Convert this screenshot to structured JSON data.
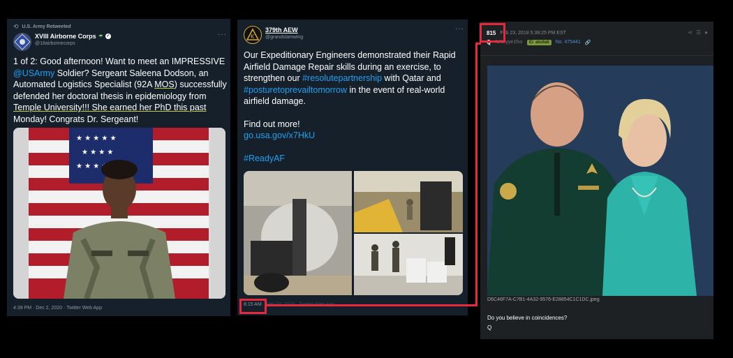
{
  "tweet1": {
    "retweet_label": "U.S. Army Retweeted",
    "display_name": "XVIII Airborne Corps",
    "handle": "@18airbornecorps",
    "text_line1": "1 of 2: Good afternoon! Want to meet an IMPRESSIVE",
    "mention": "@USArmy",
    "text_line2": " Soldier? Sergeant Saleena Dodson, an",
    "text_line3": "Automated Logistics Specialist (92A ",
    "text_mos": "MOS",
    "text_line3b": ") successfully",
    "text_line4": "defended her doctoral thesis in epidemiology from",
    "text_line5": "Temple University!!! She earned her PhD this past",
    "text_line6": "Monday! Congrats Dr. Sergeant!",
    "footer": "4:39 PM · Dec 2, 2020 · Twitter Web App"
  },
  "tweet2": {
    "display_name": "379th AEW",
    "handle": "@grandslamwing",
    "line1": "Our Expeditionary Engineers demonstrated their Rapid",
    "line2": "Airfield Damage Repair skills during an exercise, to",
    "line3a": "strengthen our ",
    "hashtag1": "#resolutepartnership",
    "line3b": " with Qatar and",
    "hashtag2": "#posturetoprevailtomorrow",
    "line4b": " in the event of real-world",
    "line5": "airfield damage.",
    "line6": "Find out more!",
    "url": "go.usa.gov/x7HkU",
    "hashtag3": "#ReadyAF",
    "footer_time": "8:15 AM",
    "footer_rest": "· Feb 23, 2018 · Twitter Web App"
  },
  "post": {
    "number": "815",
    "date": "Feb 23, 2018 5:39:25 PM EST",
    "author": "Q",
    "trip": "!UW.yye1fxo",
    "id_badge": "ID: abc8a6",
    "post_no": "No. 475441",
    "filename": "D6C46F7A-C7B1-4A32-9576-E28854C1C1DC.jpeg",
    "message": "Do you believe in coincidences?",
    "signature": "Q"
  }
}
